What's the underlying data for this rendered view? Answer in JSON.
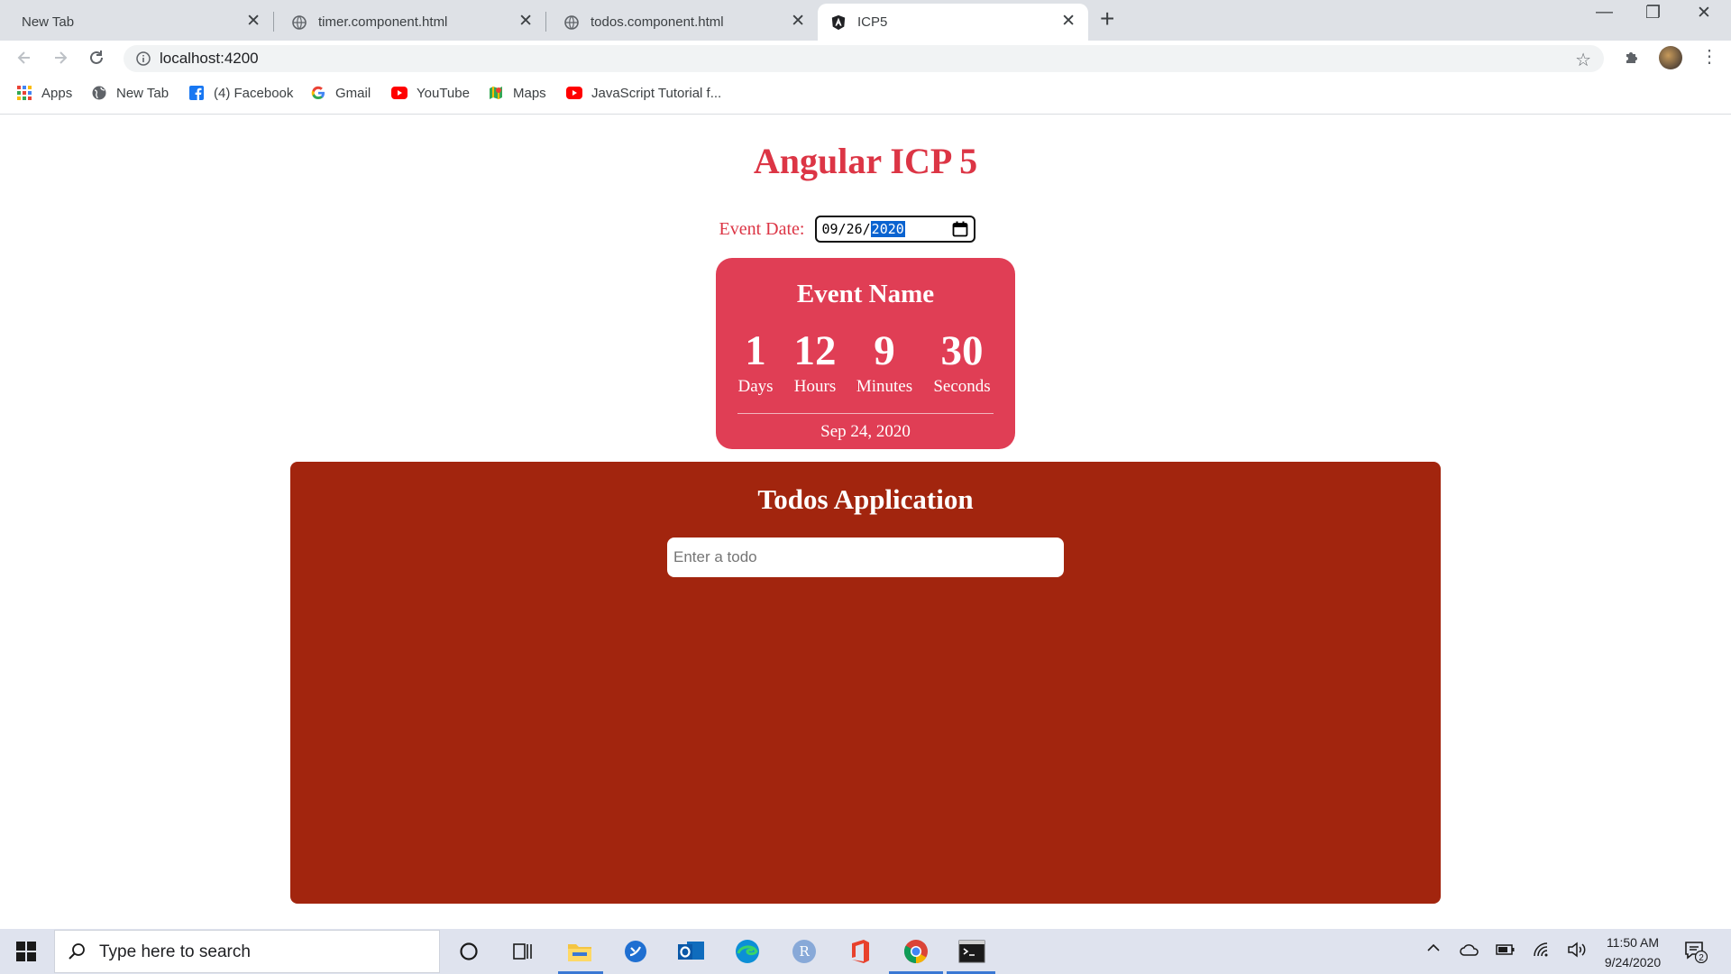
{
  "browser": {
    "tabs": [
      {
        "label": "New Tab",
        "icon": "none",
        "active": false
      },
      {
        "label": "timer.component.html",
        "icon": "globe-icon",
        "active": false
      },
      {
        "label": "todos.component.html",
        "icon": "globe-icon",
        "active": false
      },
      {
        "label": "ICP5",
        "icon": "angular-icon",
        "active": true
      }
    ],
    "url": "localhost:4200",
    "bookmarks": [
      {
        "label": "Apps",
        "icon": "apps-grid-icon"
      },
      {
        "label": "New Tab",
        "icon": "globe-icon"
      },
      {
        "label": "(4) Facebook",
        "icon": "facebook-icon"
      },
      {
        "label": "Gmail",
        "icon": "google-icon"
      },
      {
        "label": "YouTube",
        "icon": "youtube-icon"
      },
      {
        "label": "Maps",
        "icon": "maps-icon"
      },
      {
        "label": "JavaScript Tutorial f...",
        "icon": "youtube-icon"
      }
    ]
  },
  "page": {
    "title": "Angular ICP 5",
    "event_date_label": "Event Date:",
    "date_input": {
      "month": "09",
      "day": "26",
      "year": "2020",
      "separator": "/"
    },
    "timer": {
      "event_name": "Event Name",
      "units": [
        {
          "value": "1",
          "label": "Days"
        },
        {
          "value": "12",
          "label": "Hours"
        },
        {
          "value": "9",
          "label": "Minutes"
        },
        {
          "value": "30",
          "label": "Seconds"
        }
      ],
      "date": "Sep 24, 2020"
    },
    "todos": {
      "title": "Todos Application",
      "input_placeholder": "Enter a todo",
      "input_value": ""
    }
  },
  "taskbar": {
    "search_placeholder": "Type here to search",
    "time": "11:50 AM",
    "date": "9/24/2020",
    "notification_count": "2"
  },
  "colors": {
    "accent": "#dc3545",
    "timer_card": "#e03e55",
    "todos_panel": "#a2250e",
    "tab_strip": "#dee1e6"
  }
}
